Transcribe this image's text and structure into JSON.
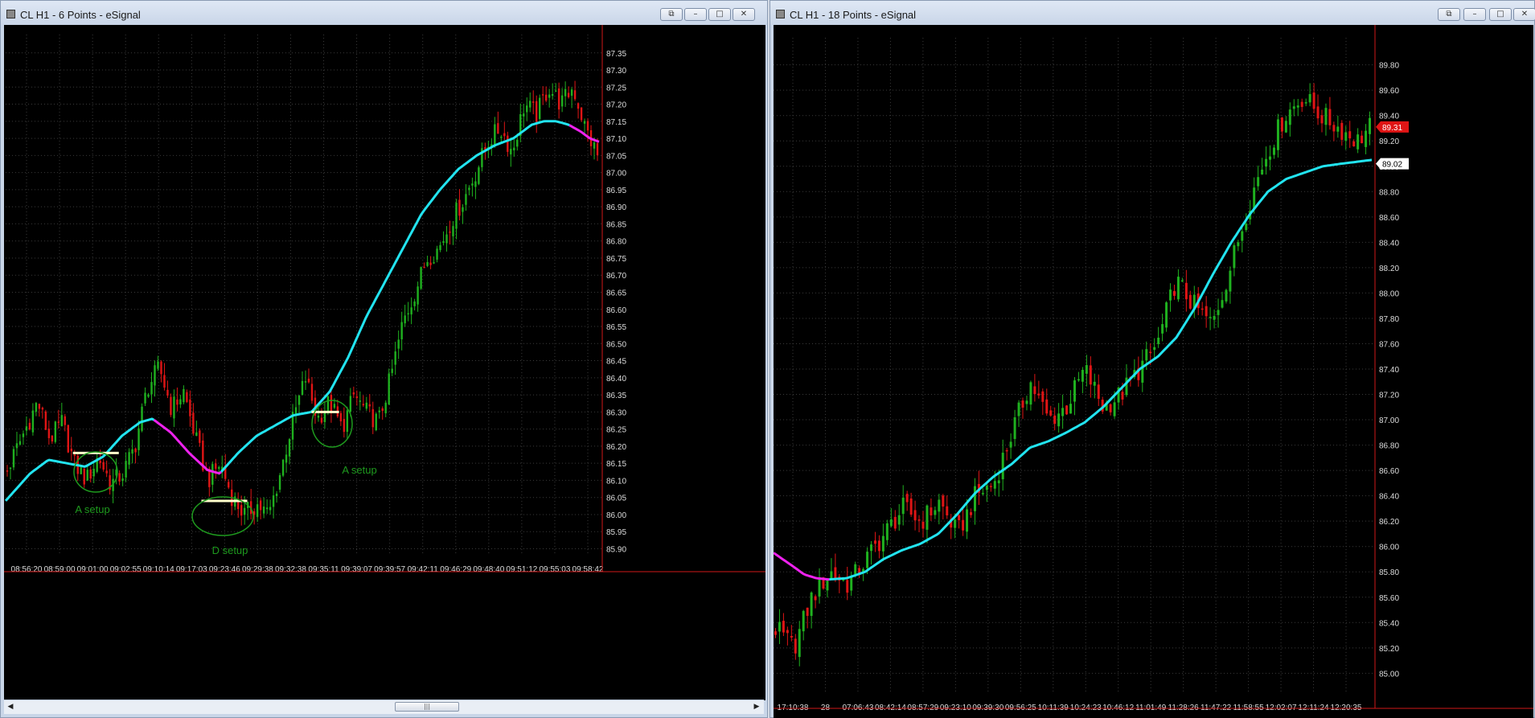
{
  "windows": [
    {
      "title": "CL H1 - 6 Points - eSignal",
      "buttons": [
        "restore",
        "minimize",
        "maximize",
        "close"
      ],
      "colors": {
        "background": "#000000",
        "grid": "#3a3a3a",
        "up_candle": "#1fb11f",
        "down_candle": "#e01515",
        "ma_up": "#22e4f0",
        "ma_down": "#ee22ee",
        "price_axis_line": "#d01818",
        "axis_text": "#dddddd"
      },
      "annotations": [
        {
          "label": "A setup",
          "color": "#1e9a1e"
        },
        {
          "label": "D setup",
          "color": "#1e9a1e"
        },
        {
          "label": "A setup",
          "color": "#1e9a1e"
        }
      ],
      "chart_data": {
        "type": "candlestick",
        "y_ticks": [
          "87.35",
          "87.30",
          "87.25",
          "87.20",
          "87.15",
          "87.10",
          "87.05",
          "87.00",
          "86.95",
          "86.90",
          "86.85",
          "86.80",
          "86.75",
          "86.70",
          "86.65",
          "86.60",
          "86.55",
          "86.50",
          "86.45",
          "86.40",
          "86.35",
          "86.30",
          "86.25",
          "86.20",
          "86.15",
          "86.10",
          "86.05",
          "86.00",
          "85.95",
          "85.90"
        ],
        "ylim": [
          85.88,
          87.38
        ],
        "x_ticks": [
          "08:56:20",
          "08:59:00",
          "09:01:00",
          "09:02:55",
          "09:10:14",
          "09:17:03",
          "09:23:46",
          "09:29:38",
          "09:32:38",
          "09:35:11",
          "09:39:07",
          "09:39:57",
          "09:42:11",
          "09:46:29",
          "09:48:40",
          "09:51:12",
          "09:55:03",
          "09:58:42"
        ],
        "close_path": [
          [
            0,
            86.13
          ],
          [
            6,
            86.25
          ],
          [
            10,
            86.33
          ],
          [
            14,
            86.22
          ],
          [
            18,
            86.27
          ],
          [
            22,
            86.15
          ],
          [
            26,
            86.1
          ],
          [
            30,
            86.17
          ],
          [
            34,
            86.09
          ],
          [
            38,
            86.12
          ],
          [
            42,
            86.2
          ],
          [
            46,
            86.37
          ],
          [
            50,
            86.43
          ],
          [
            54,
            86.31
          ],
          [
            58,
            86.36
          ],
          [
            62,
            86.22
          ],
          [
            66,
            86.1
          ],
          [
            70,
            86.15
          ],
          [
            74,
            86.05
          ],
          [
            78,
            86.0
          ],
          [
            82,
            86.03
          ],
          [
            86,
            86.0
          ],
          [
            90,
            86.13
          ],
          [
            94,
            86.28
          ],
          [
            98,
            86.4
          ],
          [
            102,
            86.28
          ],
          [
            106,
            86.33
          ],
          [
            110,
            86.25
          ],
          [
            114,
            86.35
          ],
          [
            118,
            86.3
          ],
          [
            122,
            86.27
          ],
          [
            126,
            86.4
          ],
          [
            130,
            86.56
          ],
          [
            134,
            86.65
          ],
          [
            138,
            86.75
          ],
          [
            142,
            86.78
          ],
          [
            146,
            86.86
          ],
          [
            150,
            86.92
          ],
          [
            154,
            87.0
          ],
          [
            158,
            87.09
          ],
          [
            162,
            87.13
          ],
          [
            166,
            87.06
          ],
          [
            170,
            87.2
          ],
          [
            174,
            87.17
          ],
          [
            178,
            87.25
          ],
          [
            182,
            87.2
          ],
          [
            186,
            87.25
          ],
          [
            190,
            87.13
          ],
          [
            194,
            87.05
          ]
        ],
        "ma_path": [
          [
            0,
            86.04
          ],
          [
            8,
            86.12
          ],
          [
            14,
            86.16
          ],
          [
            20,
            86.15
          ],
          [
            26,
            86.14
          ],
          [
            32,
            86.17
          ],
          [
            38,
            86.23
          ],
          [
            44,
            86.27
          ],
          [
            48,
            86.28
          ],
          [
            54,
            86.24
          ],
          [
            60,
            86.18
          ],
          [
            66,
            86.13
          ],
          [
            70,
            86.12
          ],
          [
            76,
            86.18
          ],
          [
            82,
            86.23
          ],
          [
            88,
            86.26
          ],
          [
            94,
            86.29
          ],
          [
            100,
            86.3
          ],
          [
            106,
            86.36
          ],
          [
            112,
            86.46
          ],
          [
            118,
            86.58
          ],
          [
            124,
            86.68
          ],
          [
            130,
            86.78
          ],
          [
            136,
            86.88
          ],
          [
            142,
            86.95
          ],
          [
            148,
            87.01
          ],
          [
            154,
            87.05
          ],
          [
            160,
            87.08
          ],
          [
            166,
            87.1
          ],
          [
            172,
            87.14
          ],
          [
            176,
            87.15
          ],
          [
            180,
            87.15
          ],
          [
            184,
            87.14
          ],
          [
            188,
            87.12
          ],
          [
            191,
            87.1
          ],
          [
            194,
            87.09
          ]
        ],
        "ma_down_ranges": [
          [
            48,
            70
          ],
          [
            184,
            194
          ]
        ],
        "reference_lines": [
          {
            "x0": 22,
            "x1": 37,
            "y": 86.18,
            "color": "#ffffcc"
          },
          {
            "x0": 64,
            "x1": 79,
            "y": 86.04,
            "color": "#ffffcc"
          },
          {
            "x0": 100,
            "x1": 109,
            "y": 86.3,
            "color": "#ffffcc"
          }
        ]
      }
    },
    {
      "title": "CL H1 - 18 Points - eSignal",
      "buttons": [
        "restore",
        "minimize",
        "maximize",
        "close"
      ],
      "colors": {
        "background": "#000000",
        "grid": "#3a3a3a",
        "up_candle": "#1fb11f",
        "down_candle": "#e01515",
        "ma_up": "#22e4f0",
        "ma_down": "#ee22ee",
        "price_axis_line": "#d01818",
        "axis_text": "#dddddd"
      },
      "price_labels": [
        {
          "text": "89.31",
          "value": 89.31,
          "color": "#e01515"
        },
        {
          "text": "89.02",
          "value": 89.02,
          "color": "#ffffff"
        }
      ],
      "chart_data": {
        "type": "candlestick",
        "y_ticks": [
          "89.80",
          "89.60",
          "89.40",
          "89.20",
          "89.00",
          "88.80",
          "88.60",
          "88.40",
          "88.20",
          "88.00",
          "87.80",
          "87.60",
          "87.40",
          "87.20",
          "87.00",
          "86.80",
          "86.60",
          "86.40",
          "86.20",
          "86.00",
          "85.80",
          "85.60",
          "85.40",
          "85.20",
          "85.00"
        ],
        "ylim": [
          84.85,
          89.95
        ],
        "x_ticks": [
          "17:10:38",
          "28",
          "07:06:43",
          "08:42:14",
          "08:57:29",
          "09:23:10",
          "09:39:30",
          "09:56:25",
          "10:11:39",
          "10:24:23",
          "10:46:12",
          "11:01:49",
          "11:28:26",
          "11:47:22",
          "11:58:55",
          "12:02:07",
          "12:11:24",
          "12:20:35"
        ],
        "close_path": [
          [
            0,
            85.35
          ],
          [
            6,
            85.2
          ],
          [
            12,
            85.6
          ],
          [
            18,
            85.8
          ],
          [
            24,
            85.7
          ],
          [
            30,
            85.9
          ],
          [
            36,
            86.1
          ],
          [
            42,
            86.3
          ],
          [
            48,
            86.2
          ],
          [
            54,
            86.35
          ],
          [
            60,
            86.1
          ],
          [
            66,
            86.4
          ],
          [
            72,
            86.5
          ],
          [
            78,
            86.9
          ],
          [
            84,
            87.3
          ],
          [
            90,
            87.0
          ],
          [
            96,
            87.1
          ],
          [
            102,
            87.4
          ],
          [
            108,
            87.1
          ],
          [
            114,
            87.2
          ],
          [
            120,
            87.4
          ],
          [
            126,
            87.6
          ],
          [
            132,
            88.1
          ],
          [
            138,
            87.9
          ],
          [
            144,
            87.75
          ],
          [
            150,
            88.2
          ],
          [
            156,
            88.7
          ],
          [
            162,
            89.1
          ],
          [
            168,
            89.4
          ],
          [
            174,
            89.55
          ],
          [
            180,
            89.4
          ],
          [
            186,
            89.3
          ],
          [
            192,
            89.2
          ],
          [
            196,
            89.31
          ]
        ],
        "ma_path": [
          [
            0,
            85.95
          ],
          [
            6,
            85.85
          ],
          [
            10,
            85.78
          ],
          [
            14,
            85.75
          ],
          [
            18,
            85.74
          ],
          [
            24,
            85.75
          ],
          [
            30,
            85.8
          ],
          [
            36,
            85.9
          ],
          [
            42,
            85.97
          ],
          [
            48,
            86.02
          ],
          [
            54,
            86.1
          ],
          [
            60,
            86.25
          ],
          [
            66,
            86.42
          ],
          [
            72,
            86.55
          ],
          [
            78,
            86.65
          ],
          [
            84,
            86.78
          ],
          [
            90,
            86.83
          ],
          [
            96,
            86.9
          ],
          [
            102,
            86.98
          ],
          [
            108,
            87.1
          ],
          [
            114,
            87.25
          ],
          [
            120,
            87.4
          ],
          [
            126,
            87.5
          ],
          [
            132,
            87.65
          ],
          [
            138,
            87.88
          ],
          [
            144,
            88.15
          ],
          [
            150,
            88.4
          ],
          [
            156,
            88.62
          ],
          [
            162,
            88.8
          ],
          [
            168,
            88.9
          ],
          [
            174,
            88.95
          ],
          [
            180,
            89.0
          ],
          [
            186,
            89.02
          ],
          [
            196,
            89.05
          ]
        ],
        "ma_down_ranges": [
          [
            0,
            18
          ]
        ]
      }
    }
  ]
}
